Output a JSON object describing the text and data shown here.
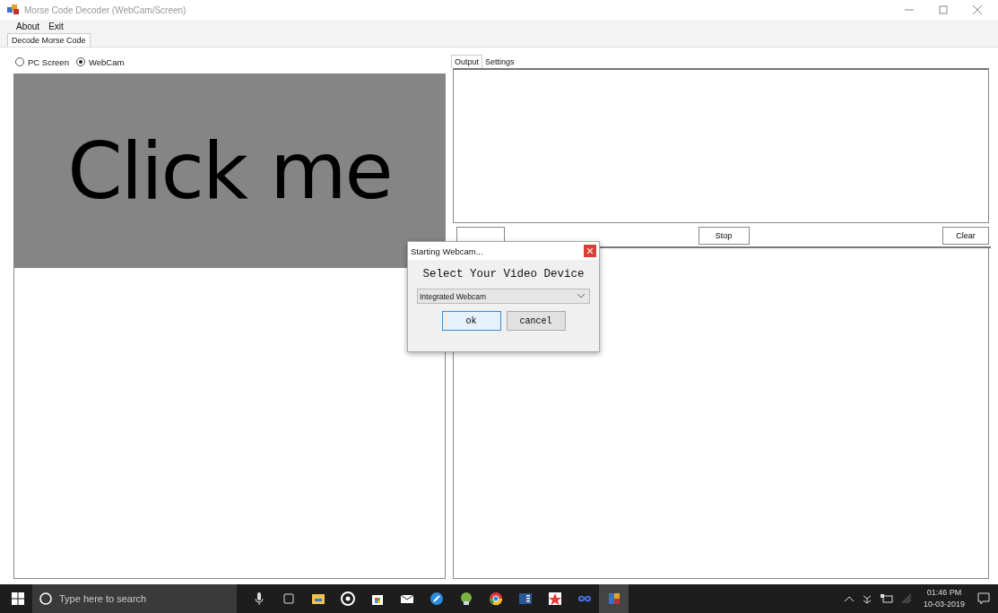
{
  "window": {
    "title": "Morse Code Decoder (WebCam/Screen)"
  },
  "menu": [
    "About",
    "Exit"
  ],
  "tabs": [
    {
      "label": "Decode Morse Code",
      "selected": true
    }
  ],
  "source": [
    {
      "label": "PC Screen",
      "selected": false
    },
    {
      "label": "WebCam",
      "selected": true
    }
  ],
  "preview": {
    "text": "Click me"
  },
  "output_tabs": [
    {
      "label": "Output",
      "selected": true
    },
    {
      "label": "Settings",
      "selected": false
    }
  ],
  "buttons": [
    {
      "kind": "start"
    },
    {
      "kind": "stop",
      "label": "Stop"
    },
    {
      "kind": "clear",
      "label": "Clear"
    }
  ],
  "dialog": {
    "title": "Starting Webcam...",
    "heading": "Select Your Video Device",
    "device": "Integrated Webcam",
    "buttons": [
      "ok",
      "cancel"
    ]
  },
  "taskbar": {
    "search_placeholder": "Type here to search",
    "apps": [
      {
        "kind": "mic"
      },
      {
        "kind": "taskview"
      },
      {
        "kind": "folder"
      },
      {
        "kind": "groove"
      },
      {
        "kind": "store"
      },
      {
        "kind": "mail"
      },
      {
        "kind": "blue"
      },
      {
        "kind": "android"
      },
      {
        "kind": "chrome"
      },
      {
        "kind": "word"
      },
      {
        "kind": "star"
      },
      {
        "kind": "infinity"
      },
      {
        "kind": "app",
        "selected": true
      }
    ],
    "time": "01:46 PM",
    "date": "10-03-2019"
  }
}
